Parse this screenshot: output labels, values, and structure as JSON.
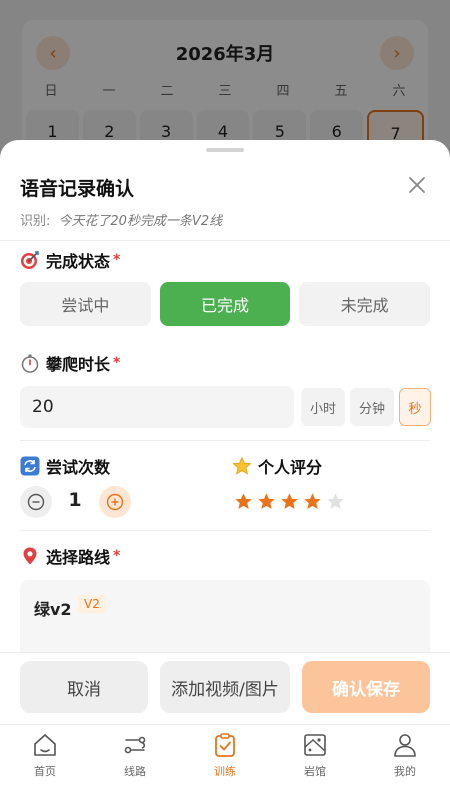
{
  "calendar": {
    "title": "2026年3月",
    "prev_label": "‹",
    "next_label": "›",
    "weekdays": [
      "日",
      "一",
      "二",
      "三",
      "四",
      "五",
      "六"
    ],
    "days": [
      "1",
      "2",
      "3",
      "4",
      "5",
      "6",
      "7"
    ],
    "selected_day": "7"
  },
  "sheet": {
    "title": "语音记录确认",
    "recognized_label": "识别:",
    "recognized_text": "今天花了20秒完成一条V2线",
    "status": {
      "label": "完成状态",
      "required": "*",
      "options": [
        "尝试中",
        "已完成",
        "未完成"
      ],
      "selected": "已完成"
    },
    "duration": {
      "label": "攀爬时长",
      "required": "*",
      "value": "20",
      "units": [
        "小时",
        "分钟",
        "秒"
      ],
      "selected_unit": "秒"
    },
    "attempts": {
      "label": "尝试次数",
      "value": "1"
    },
    "rating": {
      "label": "个人评分",
      "value": 4,
      "max": 5
    },
    "route": {
      "label": "选择路线",
      "required": "*",
      "name": "绿v2",
      "grade": "V2"
    },
    "actions": {
      "cancel": "取消",
      "media": "添加视频/图片",
      "confirm": "确认保存"
    }
  },
  "tabbar": {
    "items": [
      {
        "label": "首页",
        "icon": "home-icon"
      },
      {
        "label": "线路",
        "icon": "route-icon"
      },
      {
        "label": "训练",
        "icon": "clipboard-check-icon"
      },
      {
        "label": "岩馆",
        "icon": "climbing-wall-icon"
      },
      {
        "label": "我的",
        "icon": "user-icon"
      }
    ],
    "active": "训练"
  },
  "colors": {
    "accent": "#e8731a",
    "success": "#4caf50",
    "confirm_disabled": "#fbc49a",
    "required": "#e03c3c"
  }
}
